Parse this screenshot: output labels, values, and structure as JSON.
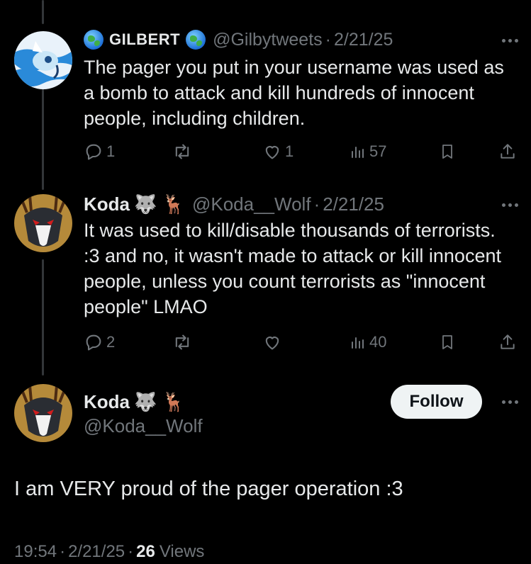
{
  "reply1": {
    "display_name": "GILBERT",
    "handle": "@Gilbytweets",
    "dot": "·",
    "date": "2/21/25",
    "text": "The pager you put in your username was used as a bomb to attack and kill hundreds of innocent people, including children.",
    "actions": {
      "replies": "1",
      "reposts": "",
      "likes": "1",
      "views": "57"
    }
  },
  "reply2": {
    "display_name": "Koda",
    "emojis": "🐺 🦌",
    "handle": "@Koda__Wolf",
    "dot": "·",
    "date": "2/21/25",
    "text": "It was used to kill/disable thousands of terrorists. :3 and no, it wasn't made to attack or kill innocent people, unless you count terrorists as \"innocent people\" LMAO",
    "actions": {
      "replies": "2",
      "reposts": "",
      "likes": "",
      "views": "40"
    }
  },
  "main_tweet": {
    "display_name": "Koda",
    "emojis": "🐺 🦌",
    "handle": "@Koda__Wolf",
    "follow_label": "Follow",
    "text": "I am VERY proud of the pager operation :3",
    "time": "19:54",
    "sep1": "·",
    "date": "2/21/25",
    "sep2": "·",
    "views_count": "26",
    "views_label": "Views"
  },
  "colors": {
    "background": "#000000",
    "text": "#e7e9ea",
    "muted": "#71767b",
    "follow_bg": "#eff3f4"
  },
  "icons": [
    "reply-icon",
    "repost-icon",
    "like-icon",
    "views-icon",
    "bookmark-icon",
    "share-icon",
    "more-icon",
    "globe-icon"
  ]
}
